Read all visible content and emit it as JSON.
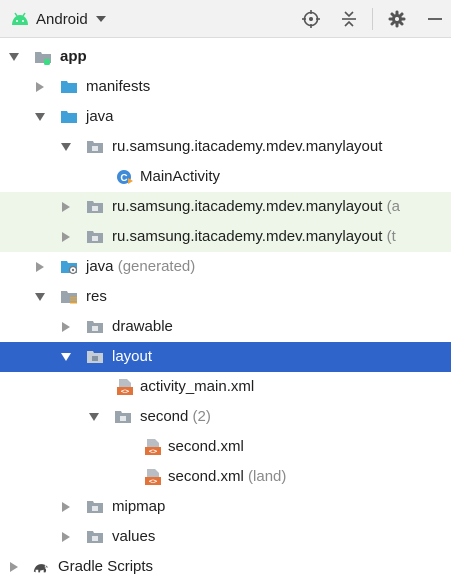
{
  "toolbar": {
    "view_label": "Android",
    "icons": [
      "android-icon",
      "dropdown-caret-icon",
      "locate-icon",
      "collapse-all-icon",
      "gear-icon",
      "minimize-icon"
    ]
  },
  "tree": {
    "app": "app",
    "manifests": "manifests",
    "java": "java",
    "pkg_main": "ru.samsung.itacademy.mdev.manylayout",
    "main_activity": "MainActivity",
    "pkg_android_test": "ru.samsung.itacademy.mdev.manylayout",
    "pkg_android_test_suffix": "(a",
    "pkg_test": "ru.samsung.itacademy.mdev.manylayout",
    "pkg_test_suffix": "(t",
    "java_generated": "java",
    "java_generated_suffix": "(generated)",
    "res": "res",
    "drawable": "drawable",
    "layout": "layout",
    "activity_main": "activity_main.xml",
    "second": "second",
    "second_count": "(2)",
    "second_xml": "second.xml",
    "second_xml_land": "second.xml",
    "second_xml_land_suffix": "(land)",
    "mipmap": "mipmap",
    "values": "values",
    "gradle_scripts": "Gradle Scripts"
  },
  "colors": {
    "selection": "#2f65ca",
    "highlight": "#edf6e8",
    "folder_blue": "#40a0d8",
    "folder_gray": "#9aa4ad",
    "android_green": "#3ddc84",
    "xml_orange": "#e2733b"
  }
}
